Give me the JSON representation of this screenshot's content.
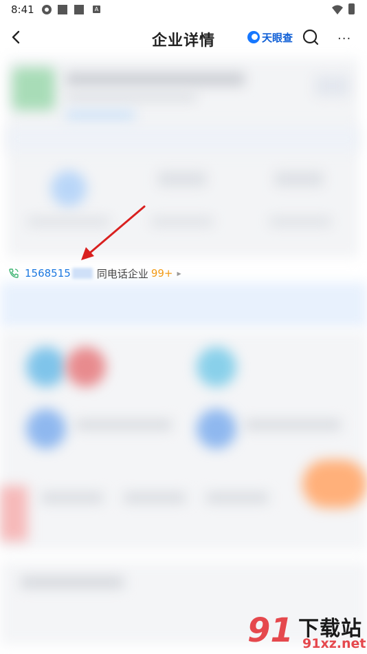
{
  "status_bar": {
    "time": "8:41",
    "notification_badge": "A"
  },
  "nav": {
    "title": "企业详情",
    "brand": "天眼查",
    "more_label": "···"
  },
  "phone_row": {
    "number_visible": "1568515",
    "label": "同电话企业",
    "count": "99+"
  },
  "watermark": {
    "logo_glyph": "91",
    "site_name": "下载站",
    "url": "91xz.net"
  },
  "colors": {
    "accent_blue": "#1b78e0",
    "count_orange": "#f29a14",
    "arrow_red": "#d9201f",
    "phone_green": "#3cb371"
  }
}
